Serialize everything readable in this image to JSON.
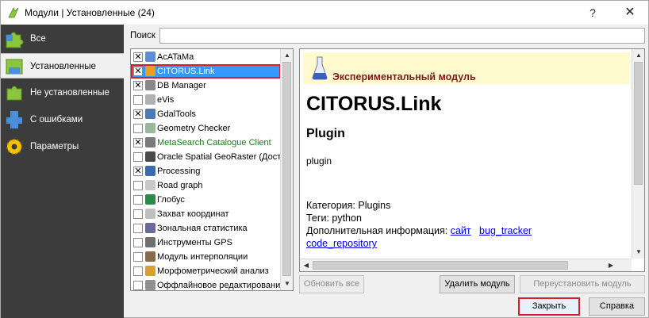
{
  "window": {
    "title": "Модули | Установленные (24)",
    "help_label": "?",
    "close_label": "✕"
  },
  "sidebar": {
    "items": [
      {
        "label": "Все",
        "icon": "puzzle-all-icon"
      },
      {
        "label": "Установленные",
        "icon": "puzzle-installed-icon"
      },
      {
        "label": "Не установленные",
        "icon": "puzzle-not-installed-icon"
      },
      {
        "label": "С ошибками",
        "icon": "puzzle-error-icon"
      },
      {
        "label": "Параметры",
        "icon": "gear-icon"
      }
    ],
    "active_index": 1
  },
  "search": {
    "label": "Поиск",
    "value": ""
  },
  "plugins": [
    {
      "name": "AcATaMa",
      "checked": true,
      "icon_color": "#5a8fd8",
      "name_color": "#000"
    },
    {
      "name": "CITORUS.Link",
      "checked": true,
      "icon_color": "#e8a020",
      "name_color": "#fff",
      "selected": true
    },
    {
      "name": "DB Manager",
      "checked": true,
      "icon_color": "#888888",
      "name_color": "#000"
    },
    {
      "name": "eVis",
      "checked": false,
      "icon_color": "#b0b0b0",
      "name_color": "#000"
    },
    {
      "name": "GdalTools",
      "checked": true,
      "icon_color": "#4a7ab8",
      "name_color": "#000"
    },
    {
      "name": "Geometry Checker",
      "checked": false,
      "icon_color": "#9ab89a",
      "name_color": "#000"
    },
    {
      "name": "MetaSearch Catalogue Client",
      "checked": true,
      "icon_color": "#7a7a7a",
      "name_color": "#1a7a1a"
    },
    {
      "name": "Oracle Spatial GeoRaster (Досту",
      "checked": false,
      "icon_color": "#4a4a4a",
      "name_color": "#000"
    },
    {
      "name": "Processing",
      "checked": true,
      "icon_color": "#3a6ab0",
      "name_color": "#000"
    },
    {
      "name": "Road graph",
      "checked": false,
      "icon_color": "#c8c8c8",
      "name_color": "#000"
    },
    {
      "name": "Глобус",
      "checked": false,
      "icon_color": "#2a8a4a",
      "name_color": "#000"
    },
    {
      "name": "Захват координат",
      "checked": false,
      "icon_color": "#c0c0c0",
      "name_color": "#000"
    },
    {
      "name": "Зональная статистика",
      "checked": false,
      "icon_color": "#6a6a9a",
      "name_color": "#000"
    },
    {
      "name": "Инструменты GPS",
      "checked": false,
      "icon_color": "#707070",
      "name_color": "#000"
    },
    {
      "name": "Модуль интерполяции",
      "checked": false,
      "icon_color": "#8a6a4a",
      "name_color": "#000"
    },
    {
      "name": "Морфометрический анализ",
      "checked": false,
      "icon_color": "#d8a030",
      "name_color": "#000"
    },
    {
      "name": "Оффлайновое редактирование",
      "checked": false,
      "icon_color": "#909090",
      "name_color": "#000"
    }
  ],
  "details": {
    "experimental_text": "Экспериментальный модуль",
    "title": "CITORUS.Link",
    "subtitle": "Plugin",
    "description": "plugin",
    "category": "Категория: Plugins",
    "tags": "Теги: python",
    "info_label": "Дополнительная информация:",
    "link_site": "сайт",
    "link_bugtracker": "bug_tracker",
    "link_repo": "code_repository"
  },
  "buttons": {
    "update_all": "Обновить все",
    "remove": "Удалить модуль",
    "reinstall": "Переустановить модуль",
    "close": "Закрыть",
    "help": "Справка"
  },
  "colors": {
    "sidebar_bg": "#3c3c3c",
    "selection": "#3399ff",
    "highlight_border": "#d3212c",
    "experimental_bg": "#fffacd",
    "experimental_text": "#7a1b1b"
  }
}
